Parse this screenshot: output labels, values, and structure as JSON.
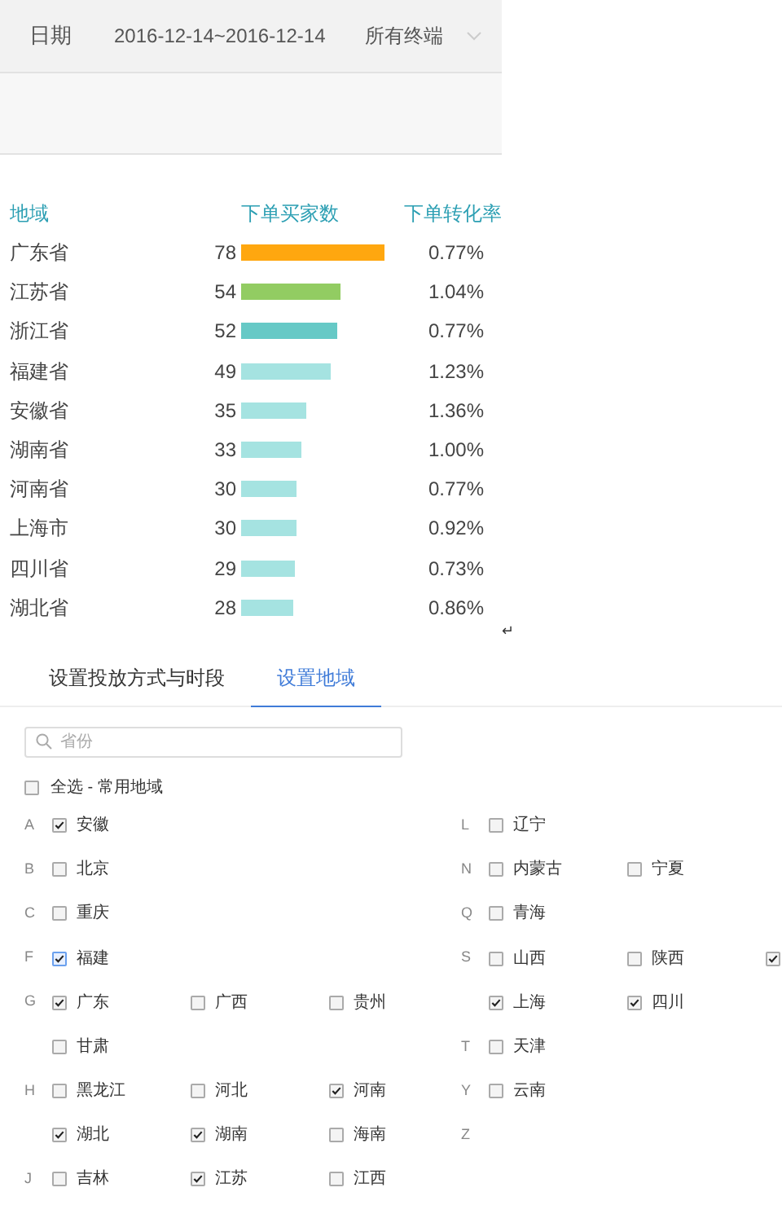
{
  "toolbar": {
    "date_label": "日期",
    "date_range": "2016-12-14~2016-12-14",
    "terminal": "所有终端"
  },
  "table": {
    "columns": [
      "地域",
      "下单买家数",
      "下单转化率"
    ],
    "rows": [
      {
        "region": "广东省",
        "buyers": "78",
        "color": "#ffa70f",
        "rate": "0.77%"
      },
      {
        "region": "江苏省",
        "buyers": "54",
        "color": "#92cc62",
        "rate": "1.04%"
      },
      {
        "region": "浙江省",
        "buyers": "52",
        "color": "#66c9c6",
        "rate": "0.77%"
      },
      {
        "region": "福建省",
        "buyers": "49",
        "color": "#a5e3e1",
        "rate": "1.23%"
      },
      {
        "region": "安徽省",
        "buyers": "35",
        "color": "#a5e3e1",
        "rate": "1.36%"
      },
      {
        "region": "湖南省",
        "buyers": "33",
        "color": "#a5e3e1",
        "rate": "1.00%"
      },
      {
        "region": "河南省",
        "buyers": "30",
        "color": "#a5e3e1",
        "rate": "0.77%"
      },
      {
        "region": "上海市",
        "buyers": "30",
        "color": "#a5e3e1",
        "rate": "0.92%"
      },
      {
        "region": "四川省",
        "buyers": "29",
        "color": "#a5e3e1",
        "rate": "0.73%"
      },
      {
        "region": "湖北省",
        "buyers": "28",
        "color": "#a5e3e1",
        "rate": "0.86%"
      }
    ],
    "return_mark": "↵"
  },
  "tabs": [
    {
      "label": "设置投放方式与时段",
      "selected": false
    },
    {
      "label": "设置地域",
      "selected": true
    }
  ],
  "search": {
    "placeholder": "省份"
  },
  "select_all": {
    "label": "全选 - 常用地域",
    "checked": false
  },
  "region_rows": [
    {
      "left": {
        "letter": "A",
        "items": [
          {
            "label": "安徽",
            "checked": true
          }
        ]
      },
      "right": {
        "letter": "L",
        "items": [
          {
            "label": "辽宁",
            "checked": false
          }
        ]
      }
    },
    {
      "left": {
        "letter": "B",
        "items": [
          {
            "label": "北京",
            "checked": false
          }
        ]
      },
      "right": {
        "letter": "N",
        "items": [
          {
            "label": "内蒙古",
            "checked": false
          },
          {
            "label": "宁夏",
            "checked": false
          }
        ]
      }
    },
    {
      "left": {
        "letter": "C",
        "items": [
          {
            "label": "重庆",
            "checked": false
          }
        ]
      },
      "right": {
        "letter": "Q",
        "items": [
          {
            "label": "青海",
            "checked": false
          }
        ]
      }
    },
    {
      "left": {
        "letter": "F",
        "items": [
          {
            "label": "福建",
            "checked": true,
            "focused": true
          }
        ]
      },
      "right": {
        "letter": "S",
        "items": [
          {
            "label": "山西",
            "checked": false
          },
          {
            "label": "陕西",
            "checked": false
          },
          {
            "checked": true
          }
        ]
      }
    },
    {
      "left": {
        "letter": "G",
        "items": [
          {
            "label": "广东",
            "checked": true
          },
          {
            "label": "广西",
            "checked": false
          },
          {
            "label": "贵州",
            "checked": false
          }
        ]
      },
      "right": {
        "items": [
          {
            "label": "上海",
            "checked": true
          },
          {
            "label": "四川",
            "checked": true
          }
        ]
      }
    },
    {
      "left": {
        "items": [
          {
            "label": "甘肃",
            "checked": false
          }
        ]
      },
      "right": {
        "letter": "T",
        "items": [
          {
            "label": "天津",
            "checked": false
          }
        ]
      }
    },
    {
      "left": {
        "letter": "H",
        "items": [
          {
            "label": "黑龙江",
            "checked": false
          },
          {
            "label": "河北",
            "checked": false
          },
          {
            "label": "河南",
            "checked": true
          }
        ]
      },
      "right": {
        "letter": "Y",
        "items": [
          {
            "label": "云南",
            "checked": false
          }
        ]
      }
    },
    {
      "left": {
        "items": [
          {
            "label": "湖北",
            "checked": true
          },
          {
            "label": "湖南",
            "checked": true
          },
          {
            "label": "海南",
            "checked": false
          }
        ]
      },
      "right": {
        "letter": "Z"
      }
    },
    {
      "left": {
        "letter": "J",
        "items": [
          {
            "label": "吉林",
            "checked": false
          },
          {
            "label": "江苏",
            "checked": true
          },
          {
            "label": "江西",
            "checked": false
          }
        ]
      }
    }
  ]
}
